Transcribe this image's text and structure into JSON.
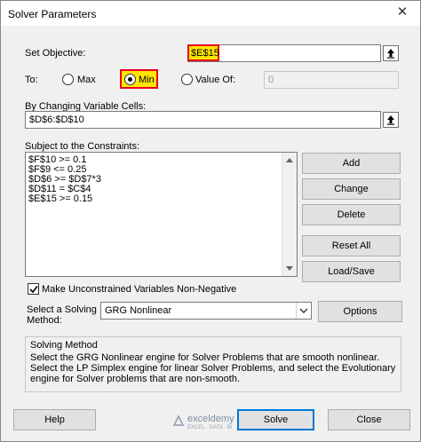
{
  "window": {
    "title": "Solver Parameters",
    "close_glyph": "✕"
  },
  "objective": {
    "label": "Set Objective:",
    "value": "$E$15"
  },
  "to": {
    "label": "To:",
    "max_label": "Max",
    "min_label": "Min",
    "value_of_label": "Value Of:",
    "value_of_value": "0",
    "selected": "Min"
  },
  "changing": {
    "label": "By Changing Variable Cells:",
    "value": "$D$6:$D$10"
  },
  "constraints": {
    "label": "Subject to the Constraints:",
    "items": [
      "$F$10 >= 0.1",
      "$F$9 <= 0.25",
      "$D$6 >= $D$7*3",
      "$D$11 = $C$4",
      "$E$15 >= 0.15"
    ]
  },
  "buttons": {
    "add": "Add",
    "change": "Change",
    "delete": "Delete",
    "reset_all": "Reset All",
    "load_save": "Load/Save",
    "options": "Options",
    "help": "Help",
    "solve": "Solve",
    "close": "Close"
  },
  "unconstrained": {
    "label": "Make Unconstrained Variables Non-Negative",
    "checked": true
  },
  "method": {
    "label_line1": "Select a Solving",
    "label_line2": "Method:",
    "value": "GRG Nonlinear"
  },
  "solving_method": {
    "title": "Solving Method",
    "description": "Select the GRG Nonlinear engine for Solver Problems that are smooth nonlinear. Select the LP Simplex engine for linear Solver Problems, and select the Evolutionary engine for Solver problems that are non-smooth."
  },
  "watermark": {
    "name": "exceldemy",
    "tagline": "EXCEL · DATA · BI"
  },
  "colors": {
    "highlight": "#ffe600",
    "highlight_border": "#e8001c",
    "default_button_border": "#0078d7"
  }
}
